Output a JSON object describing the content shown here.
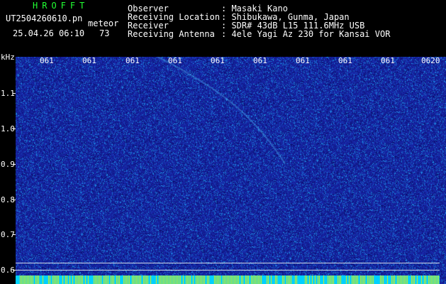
{
  "header": {
    "brand": "HROFFT",
    "file_name": "UT2504260610.pn",
    "tag": "meteor",
    "date_time": "25.04.26 06:10",
    "count": "73"
  },
  "info": {
    "observer_label": "Observer",
    "observer_value": ": Masaki Kano",
    "location_label": "Receiving Location",
    "location_value": ": Shibukawa, Gunma, Japan",
    "receiver_label": "Receiver",
    "receiver_value": ": SDR# 43dB L15 111.6MHz USB",
    "antenna_label": "Receiving Antenna",
    "antenna_value": ": 4ele Yagi Az 230 for Kansai VOR"
  },
  "axis": {
    "unit": "kHz",
    "y_ticks": [
      "1.1",
      "1.0",
      "0.9",
      "0.8",
      "0.7",
      "0.6"
    ],
    "x_ticks": [
      "061",
      "061",
      "061",
      "061",
      "061",
      "061",
      "061",
      "061",
      "061",
      "0620"
    ]
  },
  "colors": {
    "background": "#000000",
    "waterfall_base": "#1a2aa0",
    "brand_green": "#22ff33",
    "strip_yellow": "#e8f000",
    "strip_cyan": "#00d0ff"
  }
}
